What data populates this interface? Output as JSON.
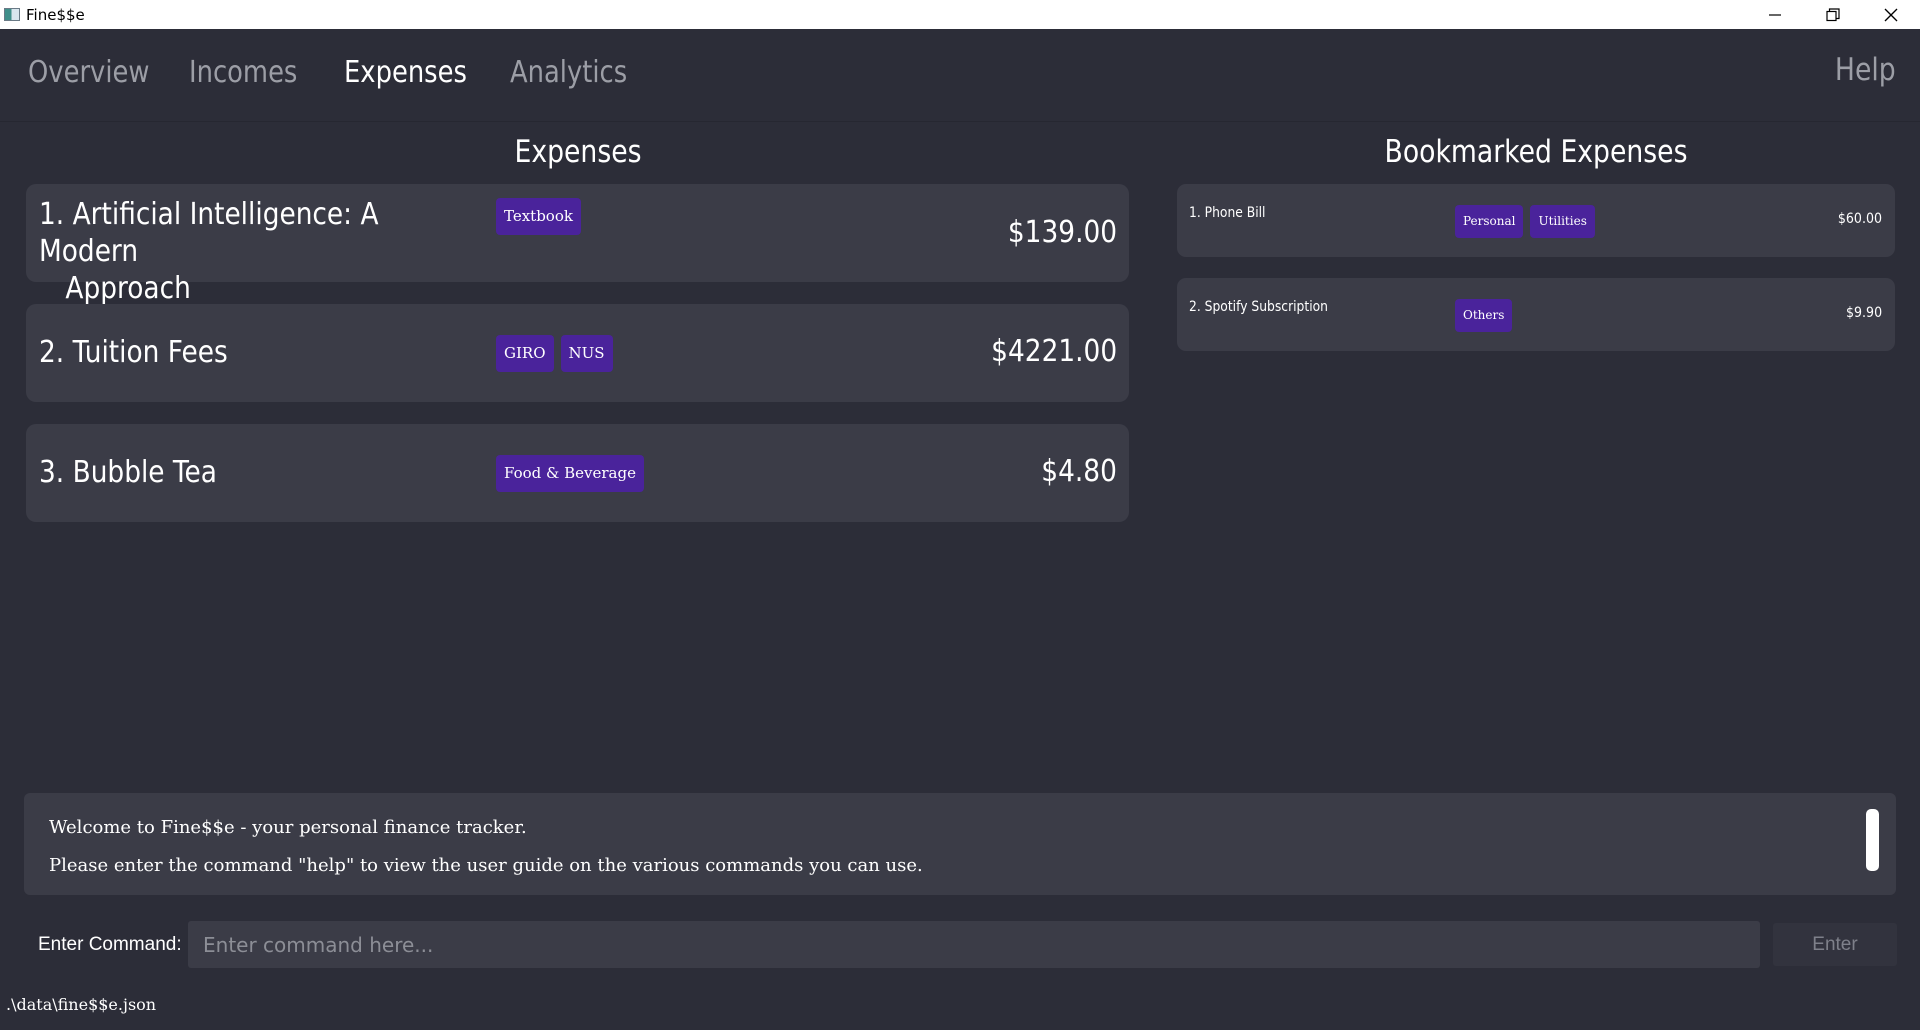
{
  "window": {
    "title": "Fine$$e"
  },
  "tabs": {
    "overview": "Overview",
    "incomes": "Incomes",
    "expenses": "Expenses",
    "analytics": "Analytics",
    "help": "Help",
    "active": "Expenses"
  },
  "expenses_panel": {
    "title": "Expenses",
    "items": [
      {
        "index": "1.",
        "name_line1": "Artificial Intelligence: A Modern",
        "name_line2": "Approach",
        "tags": [
          "Textbook"
        ],
        "amount": "$139.00"
      },
      {
        "index": "2.",
        "name": "Tuition Fees",
        "tags": [
          "GIRO",
          "NUS"
        ],
        "amount": "$4221.00"
      },
      {
        "index": "3.",
        "name": "Bubble Tea",
        "tags": [
          "Food & Beverage"
        ],
        "amount": "$4.80"
      }
    ]
  },
  "bookmarks_panel": {
    "title": "Bookmarked Expenses",
    "items": [
      {
        "name": "1. Phone Bill",
        "tags": [
          "Personal",
          "Utilities"
        ],
        "amount": "$60.00"
      },
      {
        "name": "2. Spotify Subscription",
        "tags": [
          "Others"
        ],
        "amount": "$9.90"
      }
    ]
  },
  "result": {
    "line1": "Welcome to Fine$$e - your personal finance tracker.",
    "line2": "Please enter the command \"help\" to view the user guide on the various commands you can use."
  },
  "command": {
    "label": "Enter Command:",
    "placeholder": "Enter command here...",
    "value": "",
    "button": "Enter"
  },
  "status": {
    "path": ".\\data\\fine$$e.json"
  },
  "colors": {
    "background": "#2c2d38",
    "card": "#3b3c47",
    "tag": "#4a239b",
    "text": "#ffffff",
    "muted_tab": "#9c9ea6"
  }
}
